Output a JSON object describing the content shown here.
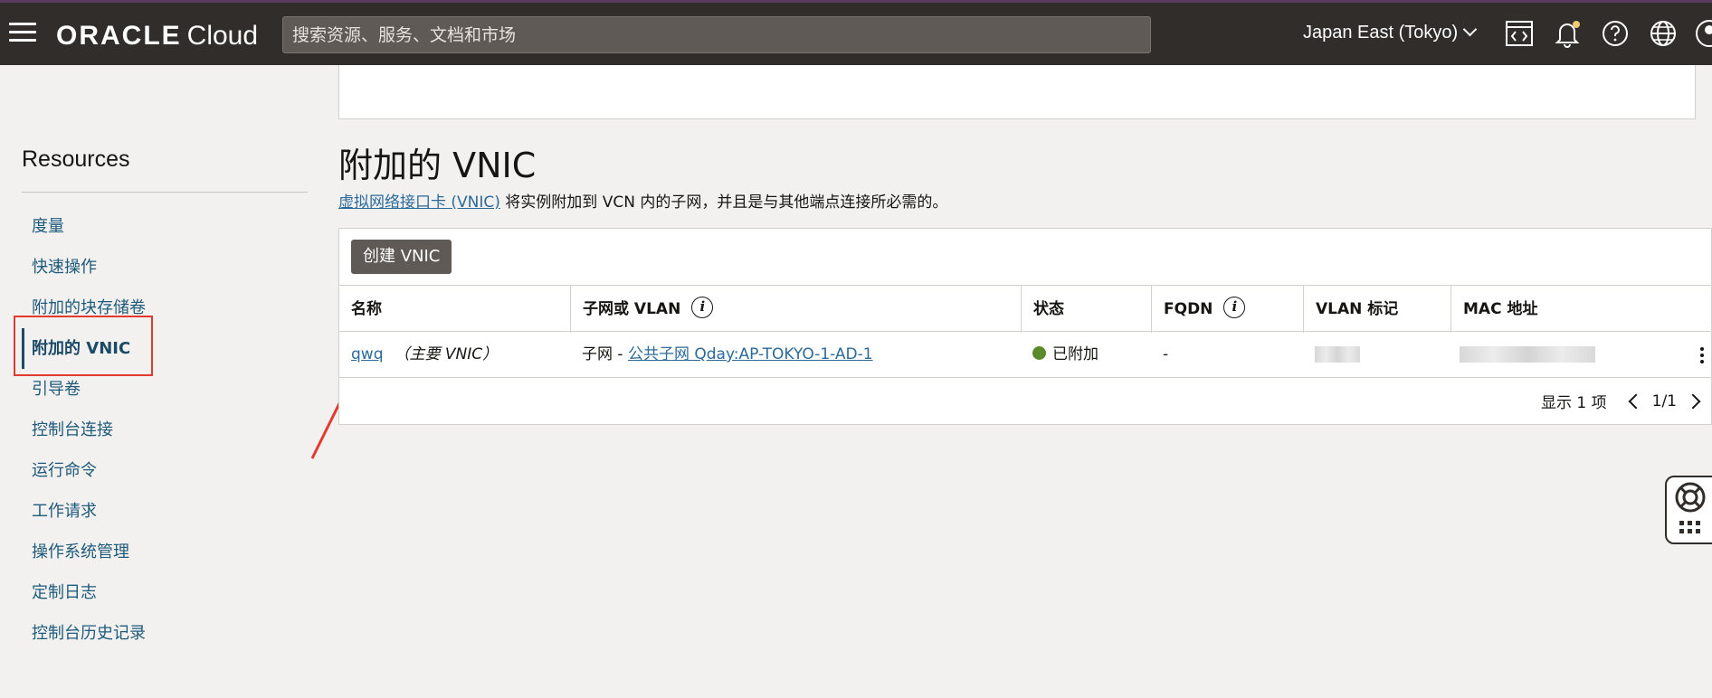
{
  "header": {
    "logo_brand": "ORACLE",
    "logo_product": "Cloud",
    "search_placeholder": "搜索资源、服务、文档和市场",
    "region": "Japan East (Tokyo)"
  },
  "sidebar": {
    "title": "Resources",
    "items": [
      {
        "label": "度量"
      },
      {
        "label": "快速操作"
      },
      {
        "label": "附加的块存储卷"
      },
      {
        "label": "附加的 VNIC",
        "active": true
      },
      {
        "label": "引导卷"
      },
      {
        "label": "控制台连接"
      },
      {
        "label": "运行命令"
      },
      {
        "label": "工作请求"
      },
      {
        "label": "操作系统管理"
      },
      {
        "label": "定制日志"
      },
      {
        "label": "控制台历史记录"
      }
    ]
  },
  "main": {
    "title": "附加的 VNIC",
    "desc_link": "虚拟网络接口卡 (VNIC)",
    "desc_text": " 将实例附加到 VCN 内的子网，并且是与其他端点连接所必需的。",
    "create_button": "创建 VNIC",
    "columns": [
      "名称",
      "子网或 VLAN",
      "状态",
      "FQDN",
      "VLAN 标记",
      "MAC 地址"
    ],
    "rows": [
      {
        "name": "qwq",
        "name_note": "（主要 VNIC）",
        "subnet_prefix": "子网 - ",
        "subnet_link": "公共子网 Qday:AP-TOKYO-1-AD-1",
        "status": "已附加",
        "fqdn": "-"
      }
    ],
    "pager_count": "显示 1 项",
    "pager_page": "1/1"
  },
  "colors": {
    "header_bg": "#312d2a",
    "link": "#2b6a9a",
    "status_ok": "#5b8a2a",
    "annotation": "#e33a2f"
  }
}
